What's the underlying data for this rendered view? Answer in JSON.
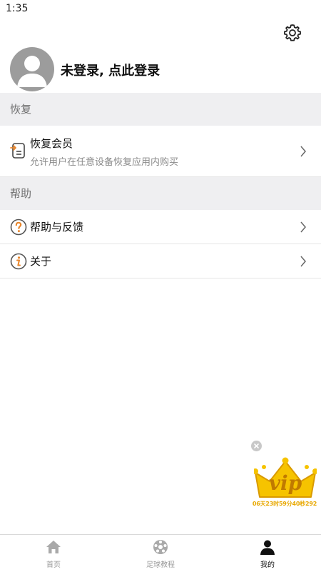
{
  "status_bar": {
    "time": "1:35"
  },
  "profile": {
    "login_text": "未登录, 点此登录"
  },
  "sections": {
    "restore": {
      "header": "恢复",
      "items": [
        {
          "title": "恢复会员",
          "subtitle": "允许用户在任意设备恢复应用内购买",
          "icon": "restore-icon"
        }
      ]
    },
    "help": {
      "header": "帮助",
      "items": [
        {
          "title": "帮助与反馈",
          "icon": "question-icon"
        },
        {
          "title": "关于",
          "icon": "info-icon"
        }
      ]
    }
  },
  "vip_promo": {
    "badge_text": "vip",
    "countdown": "06天23时59分40秒292"
  },
  "bottom_nav": {
    "items": [
      {
        "label": "首页",
        "icon": "home-icon",
        "active": false
      },
      {
        "label": "足球教程",
        "icon": "soccer-ball-icon",
        "active": false
      },
      {
        "label": "我的",
        "icon": "person-icon",
        "active": true
      }
    ]
  },
  "colors": {
    "accent_orange": "#e8862c",
    "vip_gold": "#f2b400",
    "section_bg": "#efeff1"
  }
}
